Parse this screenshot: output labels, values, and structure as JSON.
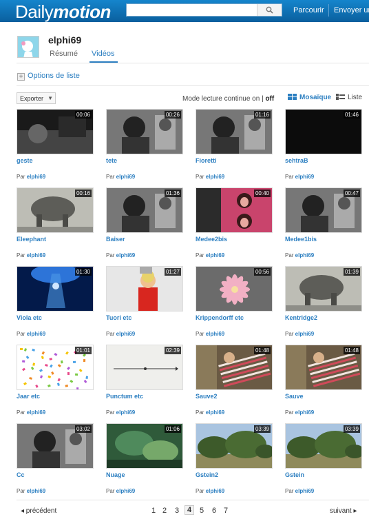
{
  "header": {
    "logo_prefix": "Daily",
    "logo_suffix": "motion",
    "search_placeholder": "",
    "nav": [
      "Parcourir",
      "Envoyer un"
    ]
  },
  "profile": {
    "username": "elphi69",
    "tabs": [
      {
        "label": "Résumé",
        "active": false
      },
      {
        "label": "Vidéos",
        "active": true
      }
    ],
    "options_label": "Options de liste"
  },
  "toolbar": {
    "export_label": "Exporter",
    "mode_label": "Mode lecture continue on | ",
    "mode_off": "off",
    "mosaic_label": "Mosaïque",
    "list_label": "Liste"
  },
  "byline_prefix": "Par",
  "videos": [
    {
      "title": "geste",
      "duration": "00:06",
      "user": "elphi69",
      "thumb": "dark"
    },
    {
      "title": "tete",
      "duration": "00:26",
      "user": "elphi69",
      "thumb": "bw"
    },
    {
      "title": "Fioretti",
      "duration": "01:16",
      "user": "elphi69",
      "thumb": "bw"
    },
    {
      "title": "sehtraB",
      "duration": "01:46",
      "user": "elphi69",
      "thumb": "black"
    },
    {
      "title": "Eleephant",
      "duration": "00:16",
      "user": "elphi69",
      "thumb": "bw-light"
    },
    {
      "title": "Baiser",
      "duration": "01:36",
      "user": "elphi69",
      "thumb": "bw"
    },
    {
      "title": "Medee2bis",
      "duration": "00:40",
      "user": "elphi69",
      "thumb": "pink"
    },
    {
      "title": "Medee1bis",
      "duration": "00:47",
      "user": "elphi69",
      "thumb": "bw"
    },
    {
      "title": "Viola etc",
      "duration": "01:30",
      "user": "elphi69",
      "thumb": "blue"
    },
    {
      "title": "Tuori etc",
      "duration": "01:27",
      "user": "elphi69",
      "thumb": "red"
    },
    {
      "title": "Krippendorff etc",
      "duration": "00:56",
      "user": "elphi69",
      "thumb": "flower"
    },
    {
      "title": "Kentridge2",
      "duration": "01:39",
      "user": "elphi69",
      "thumb": "bw-light"
    },
    {
      "title": "Jaar etc",
      "duration": "01:01",
      "user": "elphi69",
      "thumb": "confetti"
    },
    {
      "title": "Punctum etc",
      "duration": "02:39",
      "user": "elphi69",
      "thumb": "line"
    },
    {
      "title": "Sauve2",
      "duration": "01:48",
      "user": "elphi69",
      "thumb": "stripes"
    },
    {
      "title": "Sauve",
      "duration": "01:48",
      "user": "elphi69",
      "thumb": "stripes"
    },
    {
      "title": "Cc",
      "duration": "03:02",
      "user": "elphi69",
      "thumb": "bw"
    },
    {
      "title": "Nuage",
      "duration": "01:06",
      "user": "elphi69",
      "thumb": "green"
    },
    {
      "title": "Gstein2",
      "duration": "03:39",
      "user": "elphi69",
      "thumb": "trees"
    },
    {
      "title": "Gstein",
      "duration": "03:39",
      "user": "elphi69",
      "thumb": "trees"
    }
  ],
  "pagination": {
    "prev_label": "◂ précédent",
    "next_label": "suivant ▸",
    "pages": [
      "1",
      "2",
      "3",
      "4",
      "5",
      "6",
      "7"
    ],
    "current": "4"
  }
}
